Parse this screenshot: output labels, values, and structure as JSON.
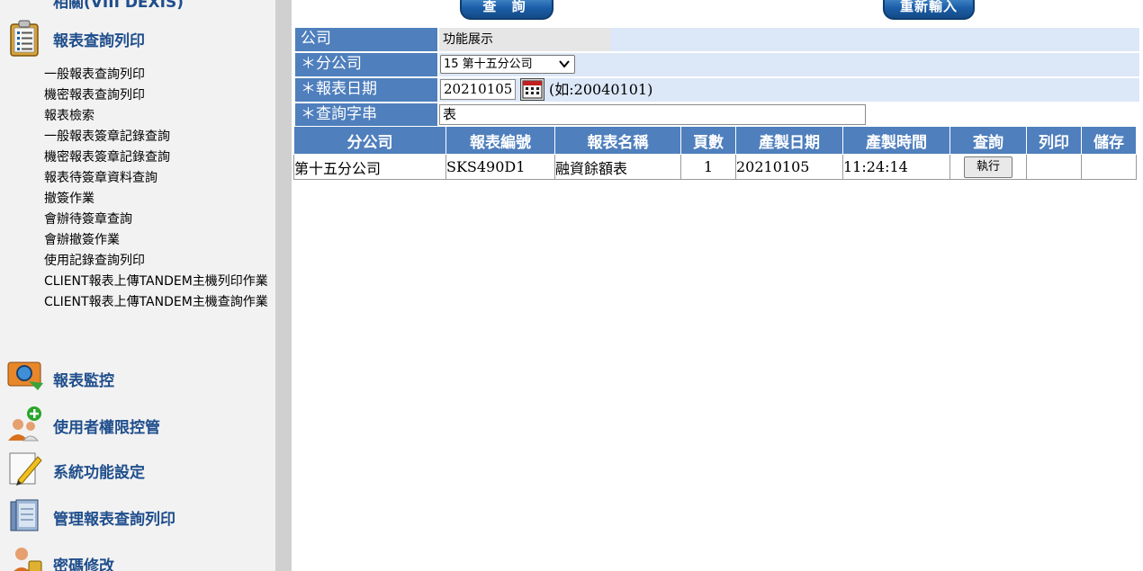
{
  "sidebar": {
    "top_section_cut": "相關(VIII DEXIS)",
    "report_section": "報表查詢列印",
    "sub_items": [
      "一般報表查詢列印",
      "機密報表查詢列印",
      "報表檢索",
      "一般報表簽章記錄查詢",
      "機密報表簽章記錄查詢",
      "報表待簽章資料查詢",
      "撤簽作業",
      "會辦待簽章查詢",
      "會辦撤簽作業",
      "使用記錄查詢列印",
      "CLIENT報表上傳TANDEM主機列印作業",
      "CLIENT報表上傳TANDEM主機查詢作業"
    ],
    "sections": [
      {
        "label": "報表監控",
        "icon": "report-monitor-icon"
      },
      {
        "label": "使用者權限控管",
        "icon": "user-permission-icon"
      },
      {
        "label": "系統功能設定",
        "icon": "system-settings-icon"
      },
      {
        "label": "管理報表查詢列印",
        "icon": "manage-report-icon"
      },
      {
        "label": "密碼修改",
        "icon": "password-icon"
      }
    ]
  },
  "toolbar": {
    "query_label": "查 詢",
    "reset_label": "重新輸入"
  },
  "form": {
    "company_label": "公司",
    "company_value": "功能展示",
    "branch_label": "＊分公司",
    "branch_value": "15 第十五分公司",
    "date_label": "＊報表日期",
    "date_value": "20210105",
    "date_hint": "(如:20040101)",
    "query_label": "＊查詢字串",
    "query_value": "表"
  },
  "table": {
    "headers": [
      "分公司",
      "報表編號",
      "報表名稱",
      "頁數",
      "產製日期",
      "產製時間",
      "查詢",
      "列印",
      "儲存"
    ],
    "rows": [
      {
        "branch": "第十五分公司",
        "report_id": "SKS490D1",
        "report_name": "融資餘額表",
        "pages": "1",
        "date": "20210105",
        "time": "11:24:14",
        "action": "執行",
        "print": "",
        "save": ""
      }
    ]
  },
  "colors": {
    "header_blue": "#4f7fbd",
    "field_bg": "#dce8f8",
    "sidebar_text": "#1f4e8c"
  }
}
